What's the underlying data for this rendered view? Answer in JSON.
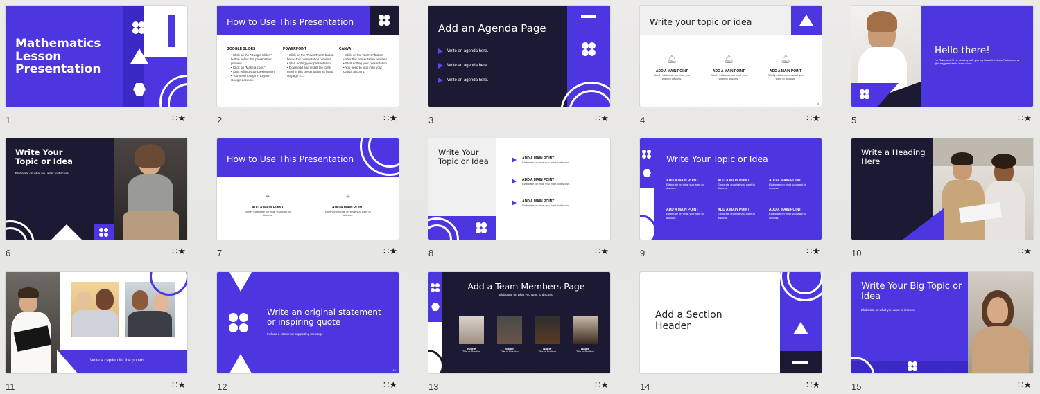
{
  "slides": [
    {
      "number": "1",
      "title": "Mathematics Lesson Presentation"
    },
    {
      "number": "2",
      "title": "How to Use This Presentation",
      "col1_head": "GOOGLE SLIDES",
      "col1_items": [
        "Click on the \"Google Slides\" button below this presentation preview.",
        "Click on \"Make a copy.\"",
        "Start editing your presentation.",
        "You need to sign in to your Google account."
      ],
      "col2_head": "POWERPOINT",
      "col2_items": [
        "Click on the \"PowerPoint\" button below this presentation preview.",
        "Start editing your presentation.",
        "Download and install the fonts used in this presentation as listed on page 21."
      ],
      "col3_head": "CANVA",
      "col3_items": [
        "Click on the \"Canva\" button under this presentation preview.",
        "Start editing your presentation.",
        "You need to sign in to your Canva account."
      ]
    },
    {
      "number": "3",
      "title": "Add an Agenda Page",
      "items": [
        "Write an agenda here.",
        "Write an agenda here.",
        "Write an agenda here."
      ]
    },
    {
      "number": "4",
      "title": "Write your topic or idea",
      "point": "ADD A MAIN POINT",
      "desc": "Briefly elaborate on what you want to discuss.",
      "page": "4"
    },
    {
      "number": "5",
      "title": "Hello there!",
      "desc": "I'm Rain, and I'll be sharing with you my beautiful ideas. Follow me at @reallygreatsite to learn more."
    },
    {
      "number": "6",
      "title": "Write Your Topic or Idea",
      "desc": "Elaborate on what you want to discuss."
    },
    {
      "number": "7",
      "title": "How to Use This Presentation",
      "point": "ADD A MAIN POINT",
      "desc": "Briefly elaborate on what you want to discuss."
    },
    {
      "number": "8",
      "title": "Write Your Topic or Idea",
      "point": "ADD A MAIN POINT",
      "desc": "Elaborate on what you want to discuss."
    },
    {
      "number": "9",
      "title": "Write Your Topic or Idea",
      "point": "ADD A MAIN POINT",
      "desc": "Elaborate on what you want to discuss."
    },
    {
      "number": "10",
      "title": "Write a Heading Here"
    },
    {
      "number": "11",
      "caption": "Write a caption for the photos."
    },
    {
      "number": "12",
      "title": "Write an original statement or inspiring quote",
      "desc": "Include a citation or supporting message",
      "page": "12"
    },
    {
      "number": "13",
      "title": "Add a Team Members Page",
      "desc": "Elaborate on what you want to discuss.",
      "member_name": "Name",
      "member_role": "Title or Position"
    },
    {
      "number": "14",
      "title": "Add a Section Header"
    },
    {
      "number": "15",
      "title": "Write Your Big Topic or Idea",
      "desc": "Elaborate on what you want to discuss."
    }
  ],
  "star_icon": "∷★",
  "colors": {
    "accent": "#4b36e0",
    "navy": "#1c1a33"
  }
}
